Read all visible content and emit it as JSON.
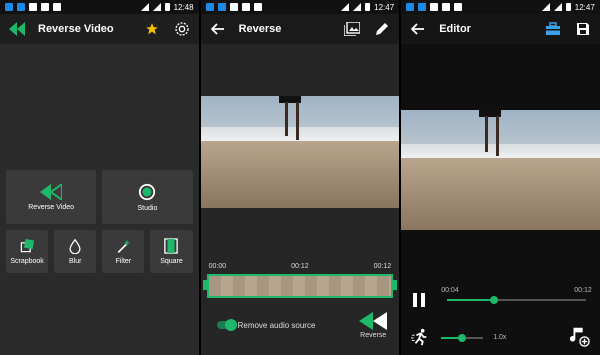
{
  "screens": [
    {
      "status_time": "12:48",
      "title": "Reverse Video",
      "tiles_main": [
        {
          "label": "Reverse Video",
          "icon": "reverse-icon"
        },
        {
          "label": "Studio",
          "icon": "studio-icon"
        }
      ],
      "tiles_small": [
        {
          "label": "Scrapbook",
          "icon": "scrapbook-icon"
        },
        {
          "label": "Blur",
          "icon": "blur-icon"
        },
        {
          "label": "Filter",
          "icon": "magic-wand-icon"
        },
        {
          "label": "Square",
          "icon": "square-icon"
        }
      ]
    },
    {
      "status_time": "12:47",
      "title": "Reverse",
      "times": [
        "00:00",
        "00:12",
        "00:12"
      ],
      "toggle_label": "Remove audio source",
      "toggle_on": true,
      "reverse_label": "Reverse"
    },
    {
      "status_time": "12:47",
      "title": "Editor",
      "position": "00:04",
      "duration": "00:12",
      "progress": 0.34,
      "speed_text": "1.0x",
      "speed_level": 0.5
    }
  ],
  "colors": {
    "accent": "#1db86a",
    "star": "#f2c000",
    "toolbar_icon_blue": "#3aa0e8"
  }
}
